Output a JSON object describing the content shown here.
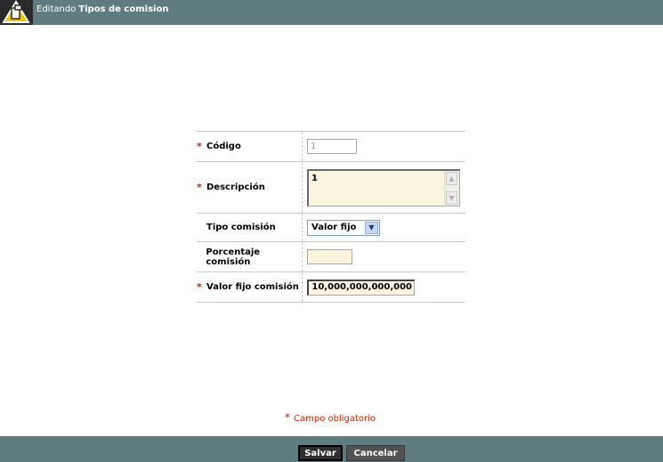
{
  "header": {
    "prefix": "Editando",
    "entity": "Tipos de comision",
    "icon": "edit-icon"
  },
  "form": {
    "codigo": {
      "label": "Código",
      "required": true,
      "value": "1"
    },
    "descripcion": {
      "label": "Descripción",
      "required": true,
      "value": "1"
    },
    "tipo_comision": {
      "label": "Tipo comisión",
      "required": false,
      "value": "Valor fijo"
    },
    "porcentaje": {
      "label": "Porcentaje comisión",
      "required": false,
      "value": ""
    },
    "valor_fijo": {
      "label": "Valor fijo comisión",
      "required": true,
      "value": "10,000,000,000,000"
    }
  },
  "required_marker": "*",
  "required_note": "Campo obligatorio",
  "footer": {
    "save_label": "Salvar",
    "cancel_label": "Cancelar"
  },
  "colors": {
    "header_bg": "#5f7c80",
    "required": "#cc2200",
    "field_bg": "#fbf4df"
  }
}
